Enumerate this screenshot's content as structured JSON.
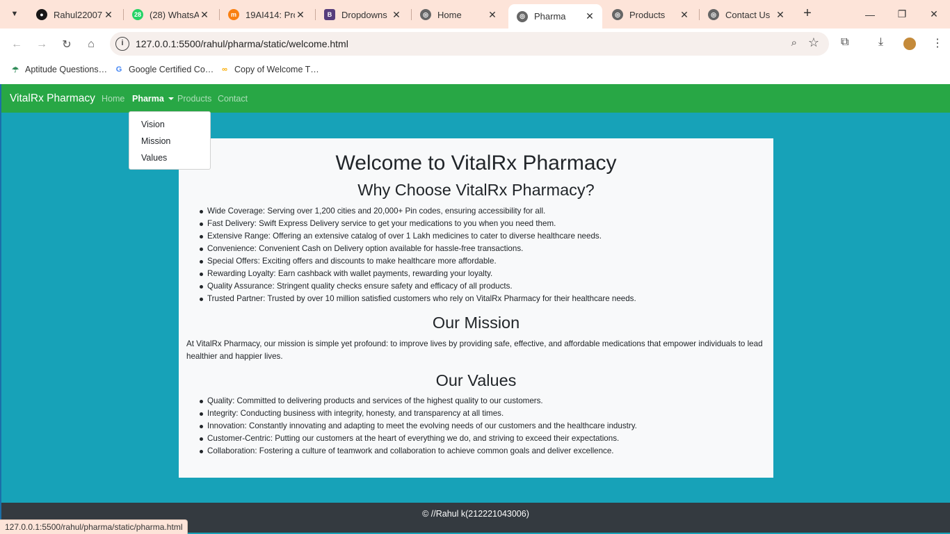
{
  "browser": {
    "tabs": [
      {
        "title": "Rahul22007…",
        "favicon": "github-icon",
        "color": "#181717"
      },
      {
        "title": "(28) WhatsA…",
        "favicon": "whatsapp-icon",
        "badge": "28",
        "color": "#25d366"
      },
      {
        "title": "19AI414: Pro…",
        "favicon": "moodle-icon",
        "color": "#f98012"
      },
      {
        "title": "Dropdowns",
        "favicon": "bootstrap-icon",
        "color": "#563d7c"
      },
      {
        "title": "Home",
        "favicon": "globe-icon",
        "color": "#555555"
      },
      {
        "title": "Pharma",
        "favicon": "globe-icon",
        "color": "#555555",
        "active": true
      },
      {
        "title": "Products",
        "favicon": "globe-icon",
        "color": "#555555"
      },
      {
        "title": "Contact Us",
        "favicon": "globe-icon",
        "color": "#555555"
      }
    ],
    "url": "127.0.0.1:5500/rahul/pharma/static/welcome.html",
    "bookmarks": [
      {
        "label": "Aptitude Questions…",
        "icon": "umbrella-icon"
      },
      {
        "label": "Google Certified Co…",
        "icon": "google-icon"
      },
      {
        "label": "Copy of Welcome T…",
        "icon": "colab-icon"
      }
    ],
    "status_url": "127.0.0.1:5500/rahul/pharma/static/pharma.html"
  },
  "navbar": {
    "brand": "VitalRx Pharmacy",
    "links": {
      "home": "Home",
      "pharma": "Pharma",
      "products": "Products",
      "contact": "Contact"
    },
    "dropdown": [
      "Vision",
      "Mission",
      "Values"
    ]
  },
  "content": {
    "title": "Welcome to VitalRx Pharmacy",
    "why_heading": "Why Choose VitalRx Pharmacy?",
    "why_items": [
      "Wide Coverage: Serving over 1,200 cities and 20,000+ Pin codes, ensuring accessibility for all.",
      "Fast Delivery: Swift Express Delivery service to get your medications to you when you need them.",
      "Extensive Range: Offering an extensive catalog of over 1 Lakh medicines to cater to diverse healthcare needs.",
      "Convenience: Convenient Cash on Delivery option available for hassle-free transactions.",
      "Special Offers: Exciting offers and discounts to make healthcare more affordable.",
      "Rewarding Loyalty: Earn cashback with wallet payments, rewarding your loyalty.",
      "Quality Assurance: Stringent quality checks ensure safety and efficacy of all products.",
      "Trusted Partner: Trusted by over 10 million satisfied customers who rely on VitalRx Pharmacy for their healthcare needs."
    ],
    "mission_heading": "Our Mission",
    "mission_text": "At VitalRx Pharmacy, our mission is simple yet profound: to improve lives by providing safe, effective, and affordable medications that empower individuals to lead healthier and happier lives.",
    "values_heading": "Our Values",
    "values_items": [
      "Quality: Committed to delivering products and services of the highest quality to our customers.",
      "Integrity: Conducting business with integrity, honesty, and transparency at all times.",
      "Innovation: Constantly innovating and adapting to meet the evolving needs of our customers and the healthcare industry.",
      "Customer-Centric: Putting our customers at the heart of everything we do, and striving to exceed their expectations.",
      "Collaboration: Fostering a culture of teamwork and collaboration to achieve common goals and deliver excellence."
    ]
  },
  "footer": {
    "text": "© //Rahul k(212221043006)"
  },
  "colors": {
    "navbar": "#28a745",
    "page_bg": "#17a2b8",
    "footer": "#343a40",
    "chrome": "#fde4d9"
  }
}
